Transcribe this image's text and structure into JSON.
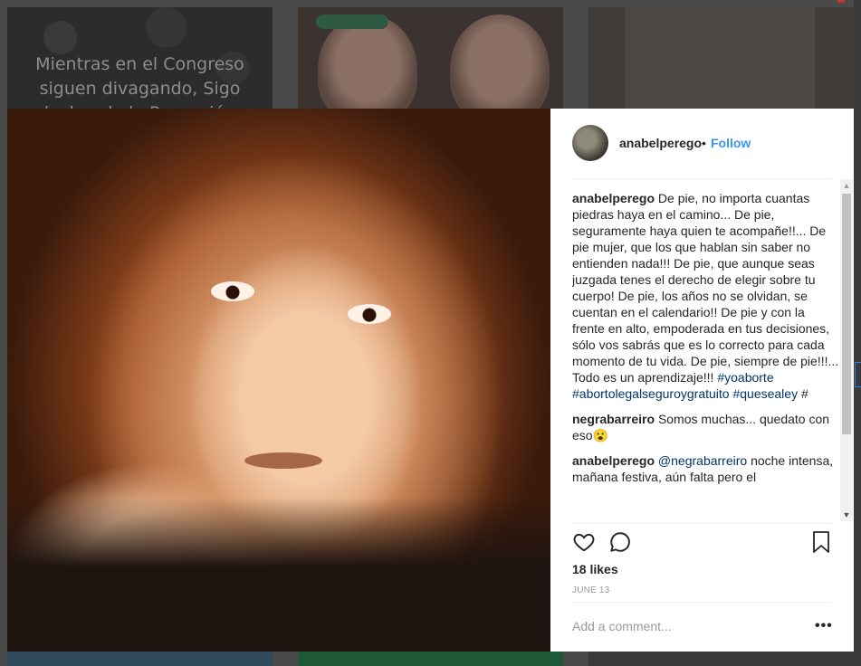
{
  "background": {
    "tile_text": "Mientras en el Congreso siguen divagando, Sigo luchando la Perma ión"
  },
  "post": {
    "username": "anabelperego",
    "header_separator": "•",
    "follow_label": "Follow",
    "caption": {
      "username": "anabelperego",
      "text": "De pie, no importa cuantas piedras haya en el camino... De pie, seguramente haya quien te acompañe!!... De pie mujer, que los que hablan sin saber no entienden nada!!! De pie, que aunque seas juzgada tenes el derecho de elegir sobre tu cuerpo! De pie, los años no se olvidan, se cuentan en el calendario!! De pie y con la frente en alto, empoderada en tus decisiones, sólo vos sabrás que es lo correcto para cada momento de tu vida. De pie, siempre de pie!!!... Todo es un aprendizaje!!!",
      "hashtags": [
        "#yoaborte",
        "#abortolegalseguroygratuito",
        "#quesealey"
      ],
      "trailing": "#"
    },
    "comments": [
      {
        "username": "negrabarreiro",
        "text": "Somos muchas... quedato con eso😮"
      },
      {
        "username": "anabelperego",
        "mention": "@negrabarreiro",
        "text": "noche intensa, mañana festiva, aún falta pero el"
      }
    ],
    "likes": "18 likes",
    "date": "JUNE 13",
    "add_comment_placeholder": "Add a comment...",
    "more_label": "•••"
  },
  "icons": {
    "heart": "heart-icon",
    "comment": "comment-icon",
    "save": "bookmark-icon",
    "more": "more-icon"
  },
  "colors": {
    "link_blue": "#3897f0",
    "hashtag": "#003569",
    "text": "#262626",
    "muted": "#999999"
  }
}
